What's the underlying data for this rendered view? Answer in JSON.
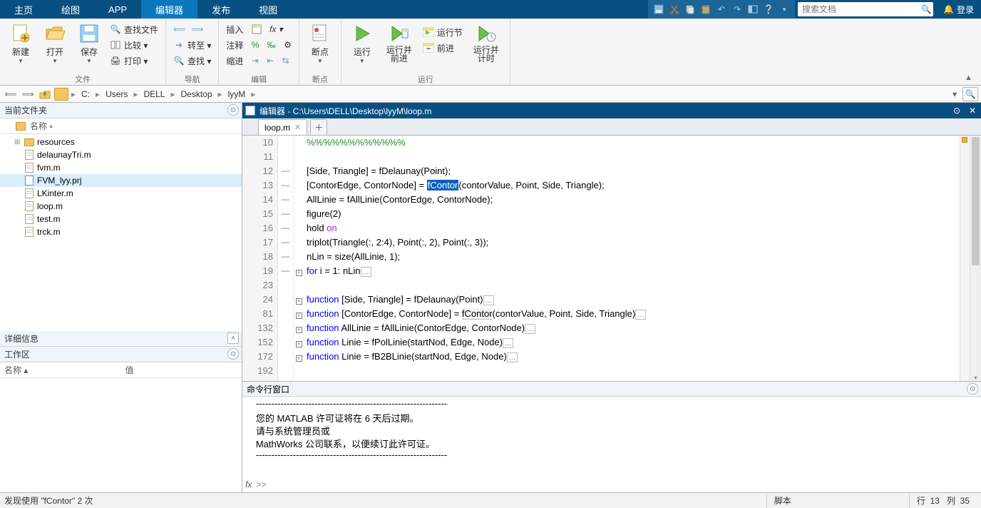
{
  "titlebar": {
    "tabs": [
      "主页",
      "绘图",
      "APP",
      "编辑器",
      "发布",
      "视图"
    ],
    "active_index": 3,
    "search_placeholder": "搜索文档",
    "login": "登录"
  },
  "ribbon": {
    "groups": [
      {
        "label": "文件",
        "big": [
          {
            "id": "new",
            "txt": "新建",
            "dd": true
          },
          {
            "id": "open",
            "txt": "打开",
            "dd": true
          },
          {
            "id": "save",
            "txt": "保存",
            "dd": true
          }
        ],
        "small": [
          {
            "id": "findfiles",
            "txt": "查找文件"
          },
          {
            "id": "compare",
            "txt": "比较  ▾"
          },
          {
            "id": "print",
            "txt": "打印  ▾"
          }
        ]
      },
      {
        "label": "导航",
        "big": [],
        "small": [
          {
            "id": "back",
            "txt": ""
          },
          {
            "id": "fwd",
            "txt": ""
          },
          {
            "id": "goto",
            "txt": "转至  ▾"
          },
          {
            "id": "find",
            "txt": "查找  ▾"
          }
        ],
        "layout": "nav"
      },
      {
        "label": "编辑",
        "big": [
          {
            "id": "insert",
            "txt": "插入",
            "dd": true
          },
          {
            "id": "comment",
            "txt": "注释"
          },
          {
            "id": "indent",
            "txt": "缩进"
          }
        ],
        "small": []
      },
      {
        "label": "断点",
        "big": [
          {
            "id": "bp",
            "txt": "断点",
            "dd": true
          }
        ],
        "small": []
      },
      {
        "label": "运行",
        "big": [
          {
            "id": "run",
            "txt": "运行",
            "dd": true
          },
          {
            "id": "runadv",
            "txt": "运行并\n前进"
          },
          {
            "id": "runsec",
            "txt": "运行节"
          },
          {
            "id": "advance",
            "txt": "前进"
          },
          {
            "id": "runtime",
            "txt": "运行并\n计时"
          }
        ],
        "small": []
      }
    ],
    "editgrid": {
      "row1": [
        "插入",
        "🔤",
        "fx  ▾"
      ],
      "row2": [
        "注释",
        "%",
        "‰",
        "⚙"
      ],
      "row3": [
        "缩进",
        "⇥",
        "⇤",
        "⇆"
      ]
    },
    "runsec_small": "运行节",
    "advance_small": "前进"
  },
  "breadcrumbs": [
    "C:",
    "Users",
    "DELL",
    "Desktop",
    "lyyM"
  ],
  "left": {
    "current_folder_title": "当前文件夹",
    "name_header": "名称",
    "detail_title": "详细信息",
    "workspace_title": "工作区",
    "ws_cols": [
      "名称 ▴",
      "值"
    ],
    "files": [
      {
        "name": "resources",
        "type": "folder",
        "exp": "⊞"
      },
      {
        "name": "delaunayTri.m",
        "type": "m"
      },
      {
        "name": "fvm.m",
        "type": "m"
      },
      {
        "name": "FVM_lyy.prj",
        "type": "prj",
        "sel": true
      },
      {
        "name": "LKinter.m",
        "type": "m"
      },
      {
        "name": "loop.m",
        "type": "m"
      },
      {
        "name": "test.m",
        "type": "m"
      },
      {
        "name": "trck.m",
        "type": "m"
      }
    ]
  },
  "editor": {
    "title": "编辑器 - C:\\Users\\DELL\\Desktop\\lyyM\\loop.m",
    "tab": "loop.m",
    "gutters": [
      "10",
      "11",
      "12",
      "13",
      "14",
      "15",
      "16",
      "17",
      "18",
      "19",
      "23",
      "24",
      "81",
      "132",
      "152",
      "172",
      "192"
    ],
    "marks": [
      "",
      "",
      "—",
      "—",
      "—",
      "—",
      "—",
      "—",
      "—",
      "—",
      "",
      "",
      "",
      "",
      "",
      "",
      ""
    ],
    "folds": [
      "",
      "",
      "",
      "",
      "",
      "",
      "",
      "",
      "",
      "+",
      "",
      "+",
      "+",
      "+",
      "+",
      "+",
      ""
    ],
    "lines": [
      {
        "t": "cm",
        "txt": "%%%%%%%%%%%%"
      },
      {
        "t": "",
        "txt": ""
      },
      {
        "t": "",
        "txt": "[Side, Triangle] = fDelaunay(Point);"
      },
      {
        "t": "contor",
        "pre": "[ContorEdge, ContorNode] = ",
        "hl": "fContor",
        "post": "(contorValue, Point, Side, Triangle);"
      },
      {
        "t": "",
        "txt": "AllLinie = fAllLinie(ContorEdge, ContorNode);"
      },
      {
        "t": "",
        "txt": "figure(2)"
      },
      {
        "t": "hold",
        "pre": "hold ",
        "kw": "on"
      },
      {
        "t": "",
        "txt": "triplot(Triangle(:, 2:4), Point(:, 2), Point(:, 3));"
      },
      {
        "t": "",
        "txt": "nLin = size(AllLinie, 1);"
      },
      {
        "t": "for",
        "kw": "for ",
        "txt": "i = 1: nLin",
        "fold": true
      },
      {
        "t": "",
        "txt": ""
      },
      {
        "t": "fn",
        "kw": "function ",
        "txt": "[Side, Triangle] = fDelaunay(Point)",
        "fold": true
      },
      {
        "t": "fn",
        "kw": "function ",
        "txt": "[ContorEdge, ContorNode] = ",
        "act": "fContor",
        "post": "(contorValue, Point, Side, Triangle)",
        "fold": true
      },
      {
        "t": "fn",
        "kw": "function ",
        "txt": "AllLinie = fAllLinie(ContorEdge, ContorNode)",
        "fold": true
      },
      {
        "t": "fn",
        "kw": "function ",
        "txt": "Linie = fPolLinie(startNod, Edge, Node)",
        "fold": true
      },
      {
        "t": "fn",
        "kw": "function ",
        "txt": "Linie = fB2BLinie(startNod, Edge, Node)",
        "fold": true
      },
      {
        "t": "",
        "txt": ""
      }
    ]
  },
  "cmd": {
    "title": "命令行窗口",
    "lines": [
      "--------------------------------------------------------------",
      "您的 MATLAB 许可证将在 6 天后过期。",
      "请与系统管理员或",
      "MathWorks 公司联系，以便续订此许可证。",
      "--------------------------------------------------------------"
    ],
    "prompt": ">>"
  },
  "status": {
    "left": "发现使用 \"fContor\" 2 次",
    "mode": "脚本",
    "ln_label": "行",
    "ln": "13",
    "col_label": "列",
    "col": "35"
  }
}
